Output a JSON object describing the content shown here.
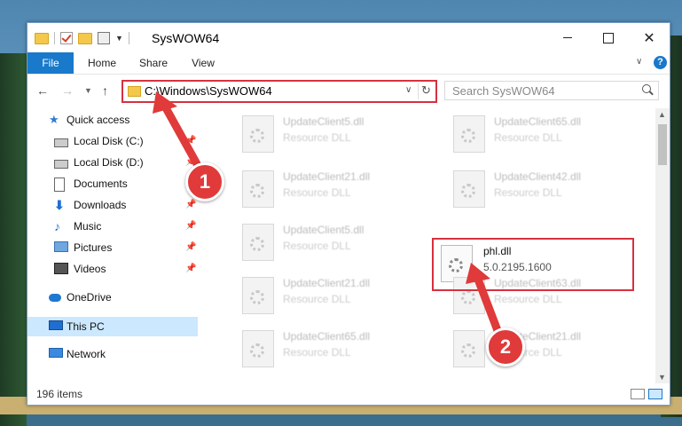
{
  "window": {
    "title": "SysWOW64"
  },
  "ribbon": {
    "tabs": [
      "File",
      "Home",
      "Share",
      "View"
    ],
    "help": "?"
  },
  "nav": {
    "address": "C:\\Windows\\SysWOW64",
    "search_placeholder": "Search SysWOW64"
  },
  "sidebar": {
    "items": [
      {
        "label": "Quick access",
        "icon": "star-icon"
      },
      {
        "label": "Local Disk (C:)",
        "icon": "drive-icon"
      },
      {
        "label": "Local Disk (D:)",
        "icon": "drive-icon"
      },
      {
        "label": "Documents",
        "icon": "documents-icon"
      },
      {
        "label": "Downloads",
        "icon": "download-icon"
      },
      {
        "label": "Music",
        "icon": "music-icon"
      },
      {
        "label": "Pictures",
        "icon": "pictures-icon"
      },
      {
        "label": "Videos",
        "icon": "videos-icon"
      },
      {
        "label": "OneDrive",
        "icon": "cloud-icon"
      },
      {
        "label": "This PC",
        "icon": "pc-icon"
      },
      {
        "label": "Network",
        "icon": "network-icon"
      }
    ]
  },
  "files": [
    {
      "name": "UpdateClient5.dll",
      "sub": "Resource DLL"
    },
    {
      "name": "UpdateClient65.dll",
      "sub": "Resource DLL"
    },
    {
      "name": "UpdateClient21.dll",
      "sub": "Resource DLL"
    },
    {
      "name": "UpdateClient42.dll",
      "sub": "Resource DLL"
    },
    {
      "name": "UpdateClient5.dll",
      "sub": "Resource DLL"
    },
    {
      "name": "phl.dll",
      "sub": "5.0.2195.1600"
    },
    {
      "name": "UpdateClient21.dll",
      "sub": "Resource DLL"
    },
    {
      "name": "UpdateClient63.dll",
      "sub": "Resource DLL"
    },
    {
      "name": "UpdateClient65.dll",
      "sub": "Resource DLL"
    },
    {
      "name": "UpdateClient21.dll",
      "sub": "Resource DLL"
    }
  ],
  "status": {
    "items": "196 items"
  },
  "annotations": {
    "step1": "1",
    "step2": "2",
    "color": "#e03a3a"
  }
}
